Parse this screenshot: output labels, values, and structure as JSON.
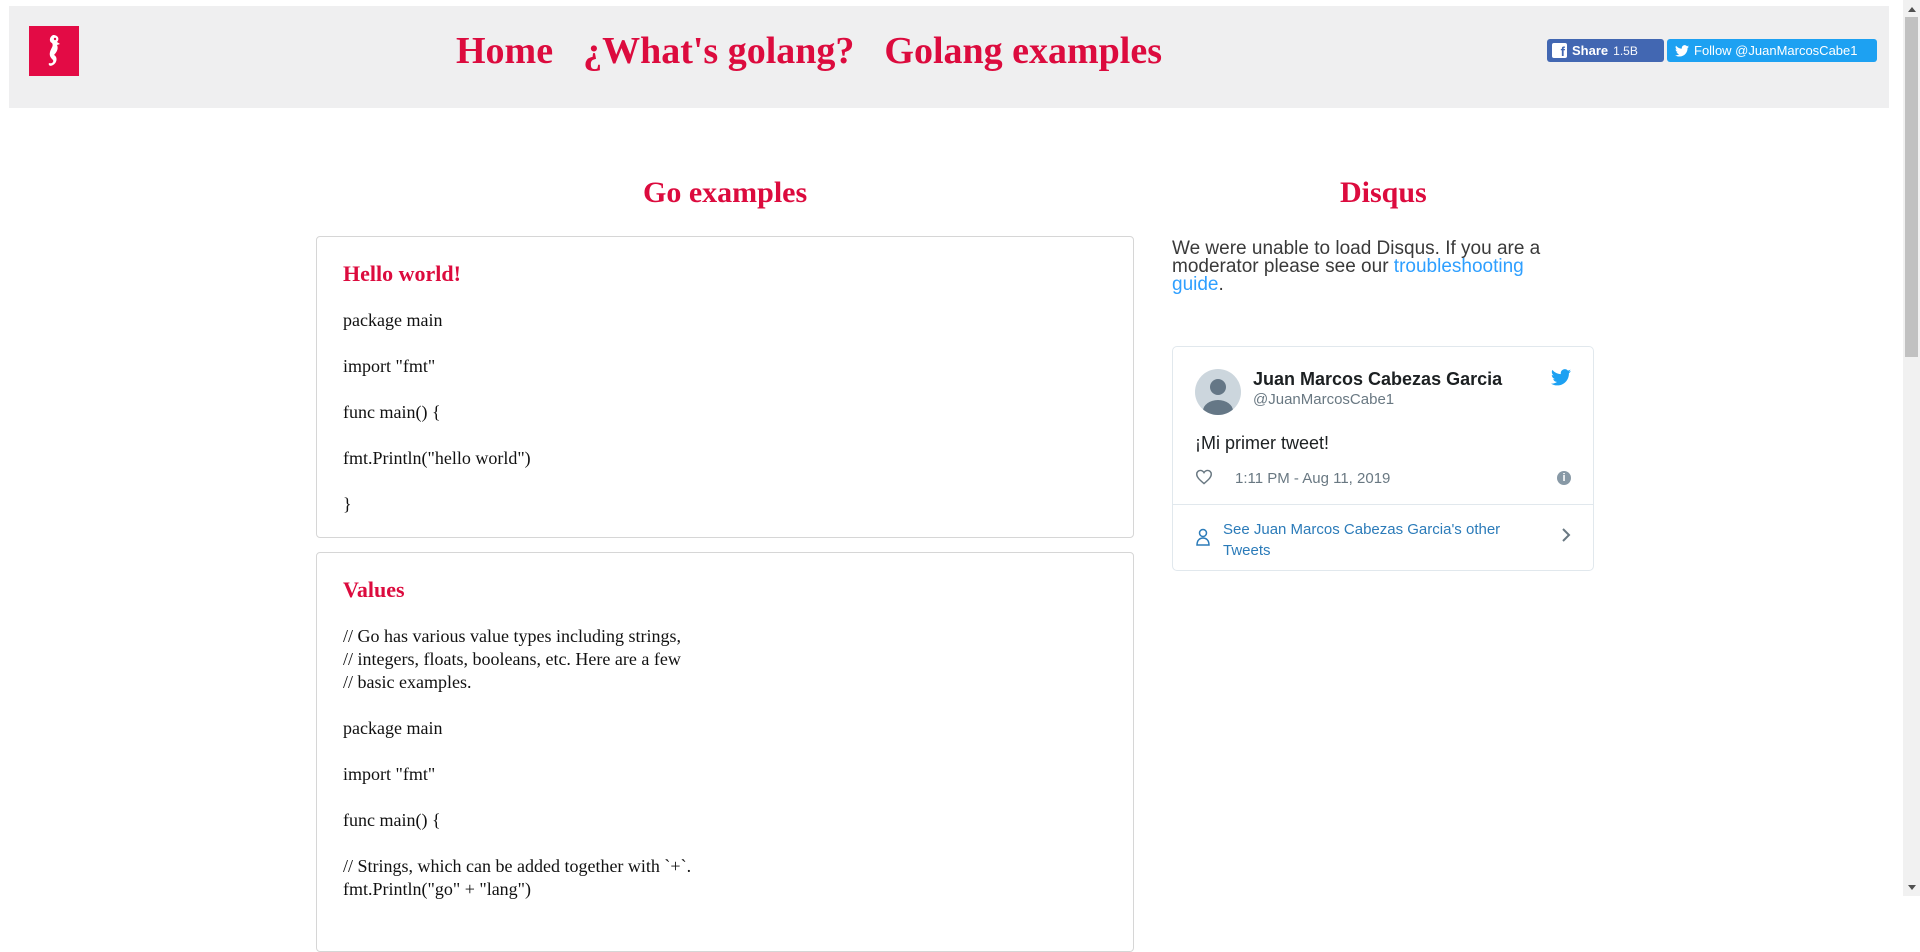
{
  "nav": {
    "home": "Home",
    "what_is": "¿What's golang?",
    "examples": "Golang examples"
  },
  "social": {
    "share_label": "Share",
    "share_count": "1.5B",
    "follow_label": "Follow @JuanMarcosCabe1"
  },
  "main": {
    "title": "Go examples",
    "cards": [
      {
        "title": "Hello world!",
        "lines": [
          "package main",
          "import \"fmt\"",
          "func main() {",
          "fmt.Println(\"hello world\")",
          "}"
        ]
      },
      {
        "title": "Values",
        "comment": [
          "// Go has various value types including strings,",
          "// integers, floats, booleans, etc. Here are a few",
          "// basic examples."
        ],
        "lines": [
          "package main",
          "import \"fmt\"",
          "func main() {"
        ],
        "tail": [
          "// Strings, which can be added together with `+`.",
          "fmt.Println(\"go\" + \"lang\")"
        ]
      }
    ]
  },
  "sidebar": {
    "title": "Disqus",
    "message_prefix": "We were unable to load Disqus. If you are a moderator please see our ",
    "message_link": "troubleshooting guide",
    "message_suffix": "."
  },
  "tweet": {
    "name": "Juan Marcos Cabezas Garcia",
    "handle": "@JuanMarcosCabe1",
    "text": "¡Mi primer tweet!",
    "time": "1:11 PM - Aug 11, 2019",
    "see_more": "See Juan Marcos Cabezas Garcia's other Tweets"
  },
  "colors": {
    "brand": "#e30b45",
    "link": "#2e9fff",
    "twitter": "#1da1f2",
    "facebook": "#4267b2"
  }
}
